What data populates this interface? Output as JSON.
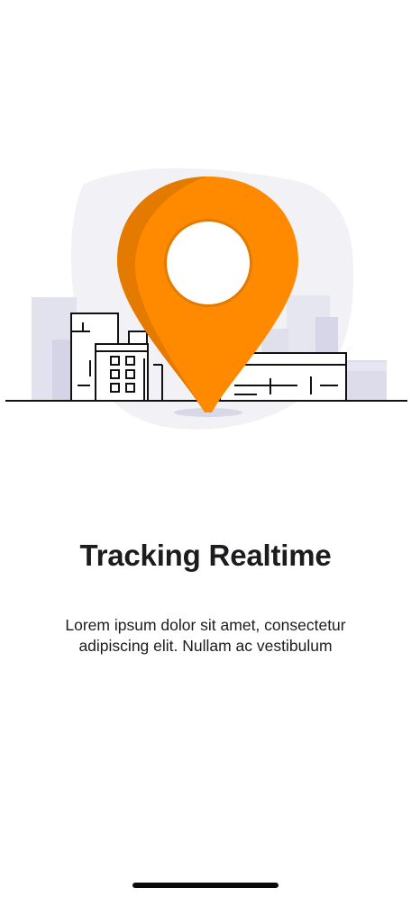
{
  "onboarding": {
    "illustration_icon": "map-pin-with-buildings",
    "title": "Tracking Realtime",
    "description": "Lorem ipsum dolor sit amet, consectetur adipiscing elit. Nullam ac vestibulum"
  },
  "colors": {
    "accent": "#FF8A00",
    "accent_dark": "#E57A00",
    "text": "#1C1C1E",
    "blob": "#F2F2F6",
    "building_fill": "#DCDCEB"
  }
}
